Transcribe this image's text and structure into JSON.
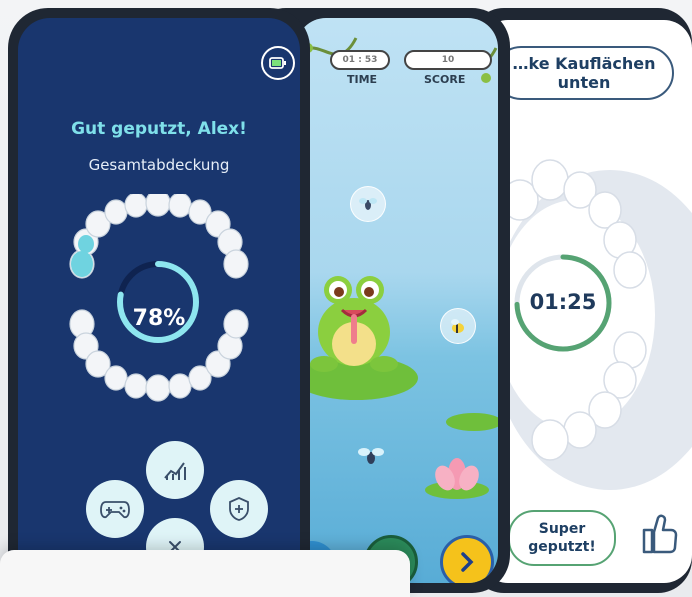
{
  "phone_right": {
    "instruction": "…ke Kauflächen unten",
    "timer": "01:25",
    "super_button": "Super geputzt!",
    "thumbs_icon": "thumbs-up-icon"
  },
  "phone_middle": {
    "hud": {
      "time_value": "01 : 53",
      "time_label": "TIME",
      "score_value": "10",
      "score_label": "SCORE"
    },
    "icons": [
      "fly-icon",
      "bee-icon",
      "frog-icon",
      "lotus-icon",
      "chevron-down-icon",
      "chevron-right-icon"
    ]
  },
  "phone_front": {
    "greeting": "Gut geputzt, Alex!",
    "coverage_label": "Gesamtabdeckung",
    "coverage_percent": "78%",
    "coverage_value": 0.78,
    "buttons": {
      "stats_icon": "chart-icon",
      "game_icon": "gamepad-icon",
      "protect_icon": "shield-plus-icon",
      "close_icon": "close-icon"
    },
    "battery_icon": "battery-icon"
  },
  "colors": {
    "front_bg": "#19366e",
    "accent_cyan": "#7fe0ea",
    "ring_track": "#0f2350",
    "button_bg": "#dff4f7",
    "green": "#56a373",
    "yellow": "#f5c21b"
  }
}
